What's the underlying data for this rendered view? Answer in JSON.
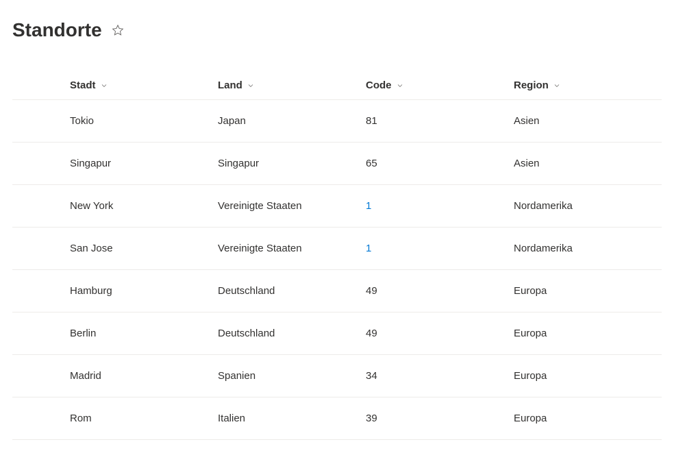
{
  "page": {
    "title": "Standorte"
  },
  "table": {
    "columns": [
      {
        "label": "Stadt"
      },
      {
        "label": "Land"
      },
      {
        "label": "Code"
      },
      {
        "label": "Region"
      }
    ],
    "rows": [
      {
        "stadt": "Tokio",
        "land": "Japan",
        "code": "81",
        "region": "Asien",
        "codeLink": false
      },
      {
        "stadt": "Singapur",
        "land": "Singapur",
        "code": "65",
        "region": "Asien",
        "codeLink": false
      },
      {
        "stadt": "New York",
        "land": "Vereinigte Staaten",
        "code": "1",
        "region": "Nordamerika",
        "codeLink": true
      },
      {
        "stadt": "San Jose",
        "land": "Vereinigte Staaten",
        "code": "1",
        "region": "Nordamerika",
        "codeLink": true
      },
      {
        "stadt": "Hamburg",
        "land": "Deutschland",
        "code": "49",
        "region": "Europa",
        "codeLink": false
      },
      {
        "stadt": "Berlin",
        "land": "Deutschland",
        "code": "49",
        "region": "Europa",
        "codeLink": false
      },
      {
        "stadt": "Madrid",
        "land": "Spanien",
        "code": "34",
        "region": "Europa",
        "codeLink": false
      },
      {
        "stadt": "Rom",
        "land": "Italien",
        "code": "39",
        "region": "Europa",
        "codeLink": false
      }
    ]
  }
}
